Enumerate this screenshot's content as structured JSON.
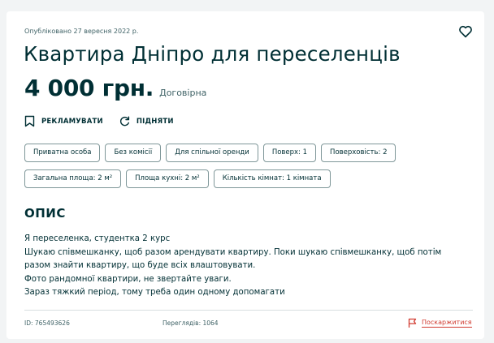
{
  "ad": {
    "published": "Опубліковано 27 вересня 2022 р.",
    "title": "Квартира Дніпро для переселенців",
    "price": "4 000 грн.",
    "negotiable": "Договірна"
  },
  "actions": {
    "advertise": "РЕКЛАМУВАТИ",
    "raise": "ПІДНЯТИ"
  },
  "tags": [
    "Приватна особа",
    "Без комісії",
    "Для спільної оренди",
    "Поверх: 1",
    "Поверховість: 2",
    "Загальна площа: 2 м²",
    "Площа кухні: 2 м²",
    "Кількість кімнат: 1 кімната"
  ],
  "description": {
    "heading": "ОПИС",
    "lines": [
      "Я переселенка, студентка 2 курс",
      "Шукаю співмешканку, щоб разом арендувати квартиру. Поки шукаю співмешканку, щоб потім",
      "разом знайти квартиру, що буде всіх влаштовувати.",
      "Фото рандомної квартири, не звертайте уваги.",
      "Зараз тяжкий період, тому треба один одному допомагати"
    ]
  },
  "footer": {
    "id": "ID: 765493626",
    "views": "Переглядів: 1064",
    "report": "Поскаржитися"
  },
  "icons": {
    "favorite": "heart-outline-icon",
    "advertise": "bookmark-icon",
    "raise": "refresh-icon",
    "report": "flag-icon"
  },
  "colors": {
    "text": "#002f34",
    "muted": "#406367",
    "border": "#7f9799",
    "report": "#d13b30",
    "background": "#f2f4f5"
  }
}
